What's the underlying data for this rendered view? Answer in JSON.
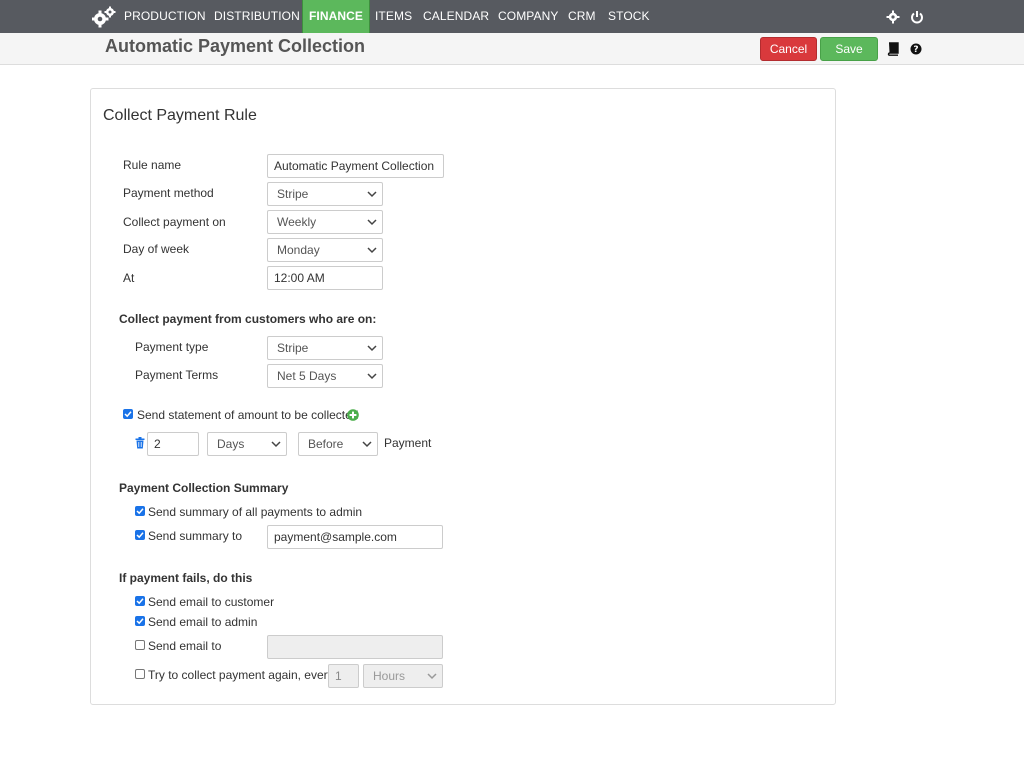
{
  "nav": {
    "items": [
      "PRODUCTION",
      "DISTRIBUTION",
      "FINANCE",
      "ITEMS",
      "CALENDAR",
      "COMPANY",
      "CRM",
      "STOCK"
    ],
    "active": "FINANCE",
    "logo_icon": "gears-icon",
    "right_icons": [
      "gear-icon",
      "power-icon"
    ]
  },
  "header": {
    "title": "Automatic Payment Collection",
    "cancel_label": "Cancel",
    "save_label": "Save",
    "icons": [
      "book-icon",
      "help-icon"
    ]
  },
  "form": {
    "title": "Collect Payment Rule",
    "rule_name_label": "Rule name",
    "rule_name_value": "Automatic Payment Collection",
    "payment_method_label": "Payment method",
    "payment_method_value": "Stripe",
    "collect_on_label": "Collect payment on",
    "collect_on_value": "Weekly",
    "day_of_week_label": "Day of week",
    "day_of_week_value": "Monday",
    "at_label": "At",
    "at_value": "12:00 AM",
    "customers_section": "Collect payment from customers who are on:",
    "payment_type_label": "Payment type",
    "payment_type_value": "Stripe",
    "payment_terms_label": "Payment Terms",
    "payment_terms_value": "Net 5 Days",
    "send_statement_label": "Send statement of amount to be collected",
    "send_statement_checked": true,
    "statement_count": "2",
    "statement_unit": "Days",
    "statement_when": "Before",
    "statement_suffix": "Payment",
    "summary_section": "Payment Collection Summary",
    "summary_all_label": "Send summary of all payments to admin",
    "summary_all_checked": true,
    "summary_to_label": "Send summary to",
    "summary_to_checked": true,
    "summary_to_value": "payment@sample.com",
    "fail_section": "If payment fails, do this",
    "email_customer_label": "Send email to customer",
    "email_customer_checked": true,
    "email_admin_label": "Send email to admin",
    "email_admin_checked": true,
    "email_to_label": "Send email to",
    "email_to_checked": false,
    "email_to_value": "",
    "retry_label": "Try to collect payment again, every",
    "retry_checked": false,
    "retry_count": "1",
    "retry_unit": "Hours"
  },
  "colors": {
    "nav_bg": "#575a60",
    "active_green": "#5cb85c",
    "cancel_red": "#d9393c",
    "checkbox_blue": "#1a73e8"
  }
}
